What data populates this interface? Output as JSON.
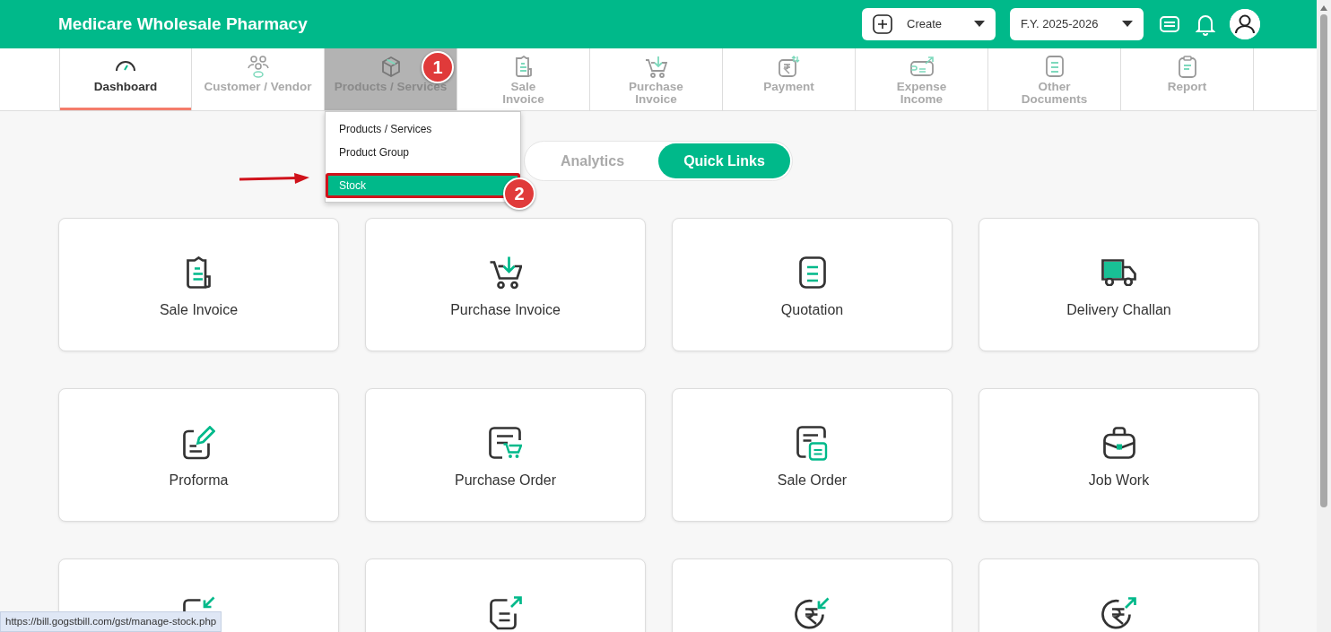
{
  "header": {
    "title": "Medicare Wholesale Pharmacy",
    "create_button": "Create",
    "year_button": "F.Y. 2025-2026"
  },
  "nav_tabs": [
    {
      "label": "Dashboard",
      "kind": "gauge",
      "selected": true,
      "hovered": false
    },
    {
      "label": "Customer / Vendor",
      "kind": "people",
      "selected": false,
      "hovered": false
    },
    {
      "label": "Products / Services",
      "kind": "box",
      "selected": false,
      "hovered": true,
      "badge": "1",
      "menu": [
        {
          "label": "Products / Services",
          "selected": false
        },
        {
          "label": "Product Group",
          "selected": false
        },
        {
          "label": "Stock",
          "selected": true,
          "badge": "2"
        }
      ]
    },
    {
      "label": "Sale\nInvoice",
      "kind": "receipt",
      "selected": false,
      "hovered": false
    },
    {
      "label": "Purchase\nInvoice",
      "kind": "cart",
      "selected": false,
      "hovered": false
    },
    {
      "label": "Payment",
      "kind": "rupee",
      "selected": false,
      "hovered": false
    },
    {
      "label": "Expense\nIncome",
      "kind": "expense",
      "selected": false,
      "hovered": false
    },
    {
      "label": "Other\nDocuments",
      "kind": "document",
      "selected": false,
      "hovered": false
    },
    {
      "label": "Report",
      "kind": "clipboard",
      "selected": false,
      "hovered": false
    }
  ],
  "view_toggle": [
    {
      "label": "Analytics",
      "selected": false
    },
    {
      "label": "Quick Links",
      "selected": true
    }
  ],
  "quick_links": [
    {
      "title": "Sale Invoice",
      "kind": "receipt"
    },
    {
      "title": "Purchase Invoice",
      "kind": "cart"
    },
    {
      "title": "Quotation",
      "kind": "document"
    },
    {
      "title": "Delivery Challan",
      "kind": "truck"
    },
    {
      "title": "Proforma",
      "kind": "pencil"
    },
    {
      "title": "Purchase Order",
      "kind": "order"
    },
    {
      "title": "Sale Order",
      "kind": "saleorder"
    },
    {
      "title": "Job Work",
      "kind": "briefcase"
    },
    {
      "kind": "docin"
    },
    {
      "kind": "docout"
    },
    {
      "kind": "rupeein"
    },
    {
      "kind": "rupeeout"
    }
  ],
  "status_url": "https://bill.gogstbill.com/gst/manage-stock.php"
}
